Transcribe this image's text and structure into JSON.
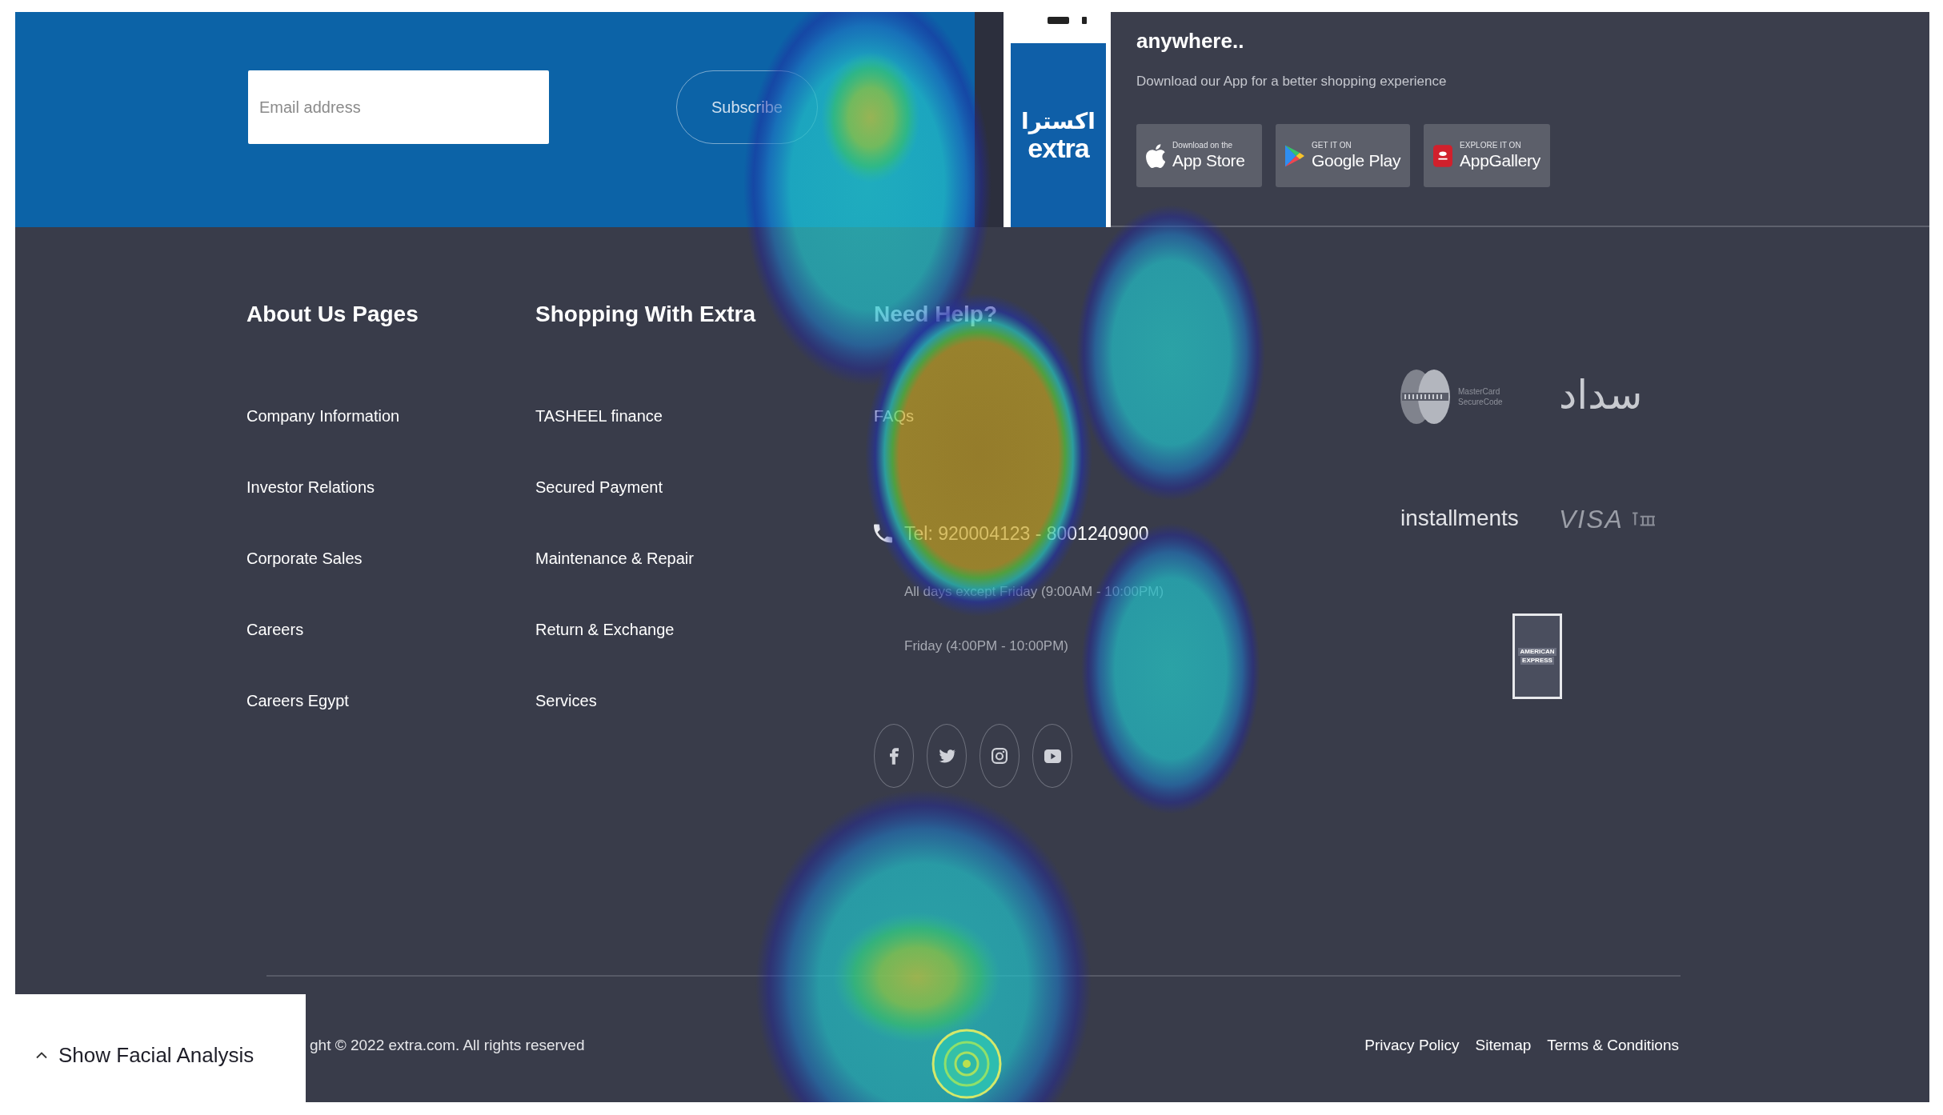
{
  "newsletter": {
    "email_field": {
      "placeholder": "Email address"
    },
    "subscribe_button": "Subscribe"
  },
  "app_promo": {
    "logo": [
      "اكسترا",
      "extra"
    ],
    "title": "anywhere..",
    "subtitle": "Download our App for a better shopping experience",
    "store_buttons": [
      {
        "kind": "apple",
        "caption": "Download on the",
        "label": "App Store"
      },
      {
        "kind": "google",
        "caption": "GET IT ON",
        "label": "Google Play"
      },
      {
        "kind": "huawei",
        "caption": "EXPLORE IT ON",
        "label": "AppGallery"
      }
    ]
  },
  "footer_columns": [
    {
      "heading": "About Us Pages",
      "links": [
        "Company Information",
        "Investor Relations",
        "Corporate Sales",
        "Careers",
        "Careers Egypt"
      ]
    },
    {
      "heading": "Shopping With Extra",
      "links": [
        "TASHEEL finance",
        "Secured Payment",
        "Maintenance & Repair",
        "Return & Exchange",
        "Services"
      ]
    }
  ],
  "need_help": {
    "heading": "Need Help?",
    "links": [
      "FAQs"
    ],
    "phone": "Tel: 920004123 - 8001240900",
    "hours": [
      "All days except Friday (9:00AM - 10:00PM)",
      "Friday (4:00PM - 10:00PM)"
    ],
    "social_links": [
      {
        "kind": "facebook"
      },
      {
        "kind": "twitter"
      },
      {
        "kind": "instagram"
      },
      {
        "kind": "youtube"
      }
    ]
  },
  "payment_methods": [
    {
      "kind": "securecode",
      "lines": [
        "MasterCard",
        "SecureCode"
      ]
    },
    {
      "kind": "sadad",
      "text": "سداد"
    },
    {
      "kind": "installments",
      "text": "installments"
    },
    {
      "kind": "visa",
      "text": "VISA"
    },
    {
      "kind": "amex",
      "lines": [
        "AMERICAN",
        "EXPRESS"
      ]
    }
  ],
  "bottom_bar": {
    "copyright": "ght © 2022 extra.com. All rights reserved",
    "links": [
      "Privacy Policy",
      "Sitemap",
      "Terms & Conditions"
    ]
  },
  "facial_analysis_toggle": {
    "label": "Show Facial Analysis",
    "expanded": false
  }
}
